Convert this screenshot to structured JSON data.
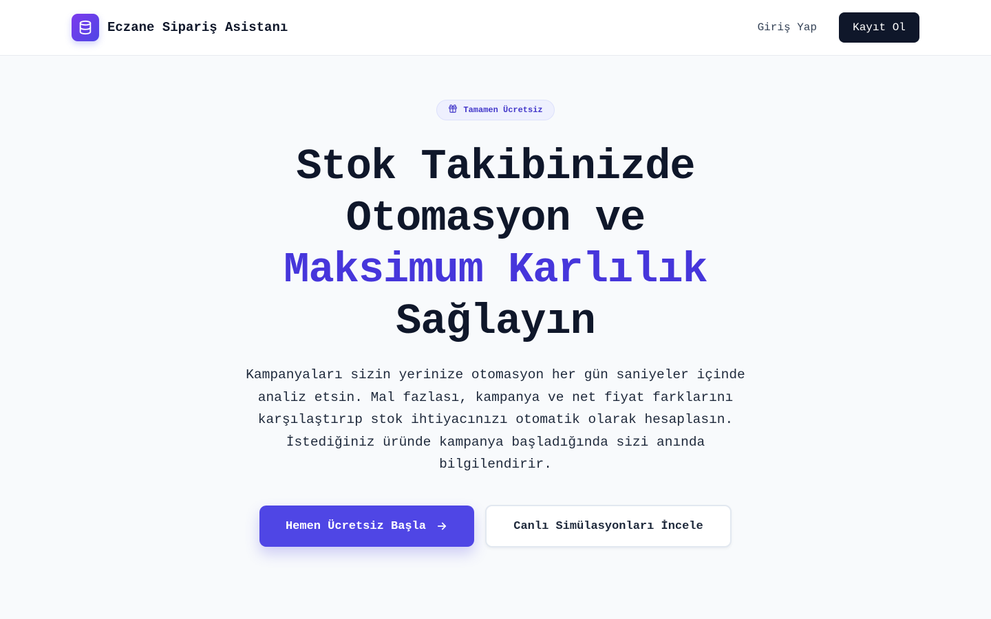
{
  "header": {
    "brand_name": "Eczane Sipariş Asistanı",
    "brand_icon": "database-icon",
    "login_label": "Giriş Yap",
    "signup_label": "Kayıt Ol"
  },
  "hero": {
    "badge": {
      "icon": "gift-icon",
      "label": "Tamamen Ücretsiz"
    },
    "headline": {
      "line1": "Stok Takibinizde",
      "line2": "Otomasyon ve",
      "line3_accent": "Maksimum Karlılık",
      "line4": "Sağlayın"
    },
    "subtitle": "Kampanyaları sizin yerinize otomasyon her gün saniyeler içinde analiz etsin. Mal fazlası, kampanya ve net fiyat farklarını karşılaştırıp stok ihtiyacınızı otomatik olarak hesaplasın. İstediğiniz üründe kampanya başladığında sizi anında bilgilendirir.",
    "cta_primary": {
      "label": "Hemen Ücretsiz Başla",
      "icon": "arrow-right-icon"
    },
    "cta_secondary": {
      "label": "Canlı Simülasyonları İncele"
    }
  },
  "colors": {
    "accent": "#4f46e5",
    "accent_text": "#4636db",
    "dark": "#0f172a",
    "background": "#f8fafc"
  }
}
